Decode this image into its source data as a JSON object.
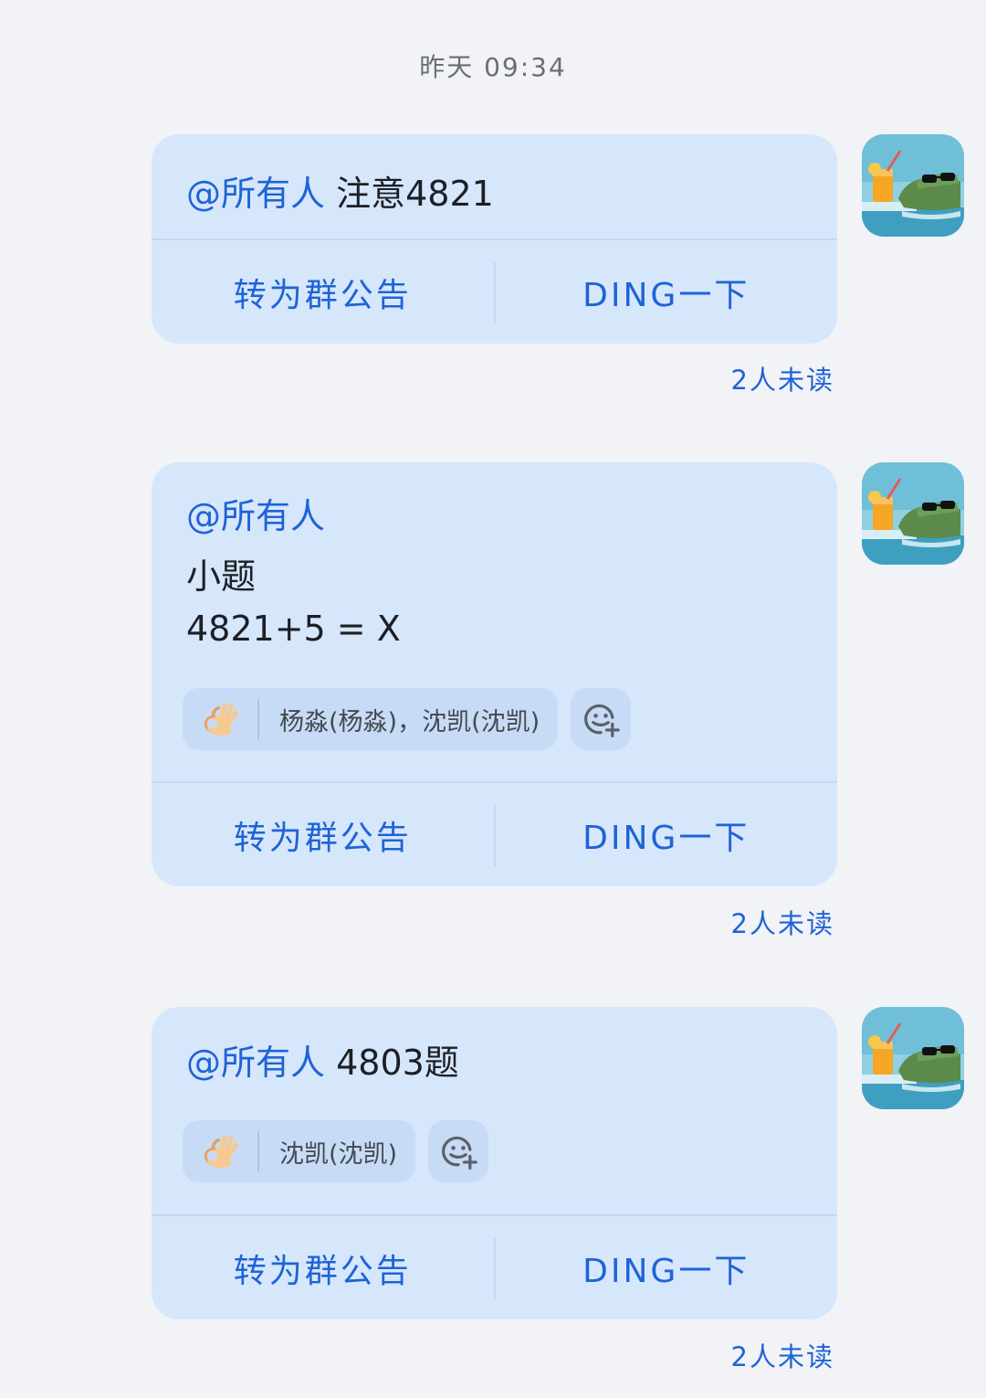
{
  "timestamp": "昨天 09:34",
  "messages": [
    {
      "mention": "@所有人",
      "text": " 注意4821",
      "actions": {
        "announce": "转为群公告",
        "ding": "DING一下"
      },
      "unread": "2人未读"
    },
    {
      "mention": "@所有人",
      "lines": [
        "小题",
        "4821+5 = X"
      ],
      "reaction": {
        "emoji": "ok-hand-icon",
        "names": "杨淼(杨淼)，沈凯(沈凯)"
      },
      "actions": {
        "announce": "转为群公告",
        "ding": "DING一下"
      },
      "unread": "2人未读"
    },
    {
      "mention": "@所有人",
      "text": " 4803题",
      "reaction": {
        "emoji": "ok-hand-icon",
        "names": "沈凯(沈凯)"
      },
      "actions": {
        "announce": "转为群公告",
        "ding": "DING一下"
      },
      "unread": "2人未读"
    }
  ],
  "colors": {
    "bubble": "#d6e7fc",
    "accent": "#1f63d6",
    "background": "#f1f3f6"
  }
}
